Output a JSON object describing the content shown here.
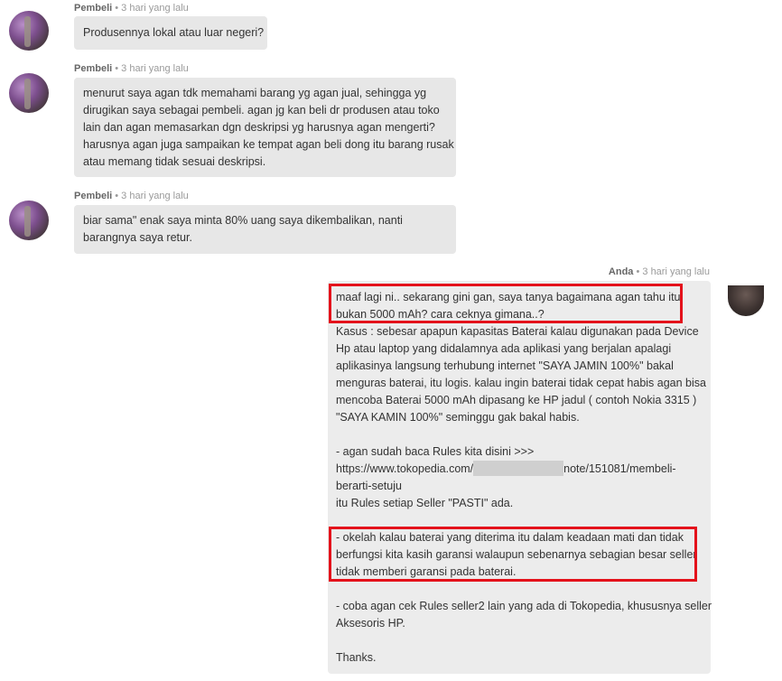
{
  "messages": [
    {
      "sender": "Pembeli",
      "time": "3 hari yang lalu",
      "lines": [
        "Produsennya lokal atau luar negeri?"
      ]
    },
    {
      "sender": "Pembeli",
      "time": "3 hari yang lalu",
      "lines": [
        "menurut saya agan tdk memahami barang yg agan jual, sehingga yg",
        "dirugikan saya sebagai pembeli. agan jg kan beli dr produsen atau toko",
        "lain dan agan memasarkan dgn deskripsi yg harusnya agan mengerti?",
        "harusnya agan juga sampaikan ke tempat agan beli dong itu barang rusak",
        "atau memang tidak sesuai deskripsi."
      ]
    },
    {
      "sender": "Pembeli",
      "time": "3 hari yang lalu",
      "lines": [
        "biar sama\" enak saya minta 80% uang saya dikembalikan, nanti",
        "barangnya saya retur."
      ]
    }
  ],
  "reply": {
    "sender": "Anda",
    "time": "3 hari yang lalu",
    "lines": [
      "maaf lagi ni.. sekarang gini gan, saya tanya bagaimana agan tahu itu",
      "bukan 5000 mAh? cara ceknya gimana..?",
      "Kasus : sebesar apapun kapasitas Baterai kalau digunakan pada Device",
      "Hp atau laptop yang didalamnya ada aplikasi yang berjalan apalagi",
      "aplikasinya langsung terhubung internet \"SAYA JAMIN 100%\" bakal",
      "menguras baterai, itu logis. kalau ingin baterai tidak cepat habis agan bisa",
      "mencoba Baterai 5000 mAh dipasang ke HP jadul ( contoh Nokia 3315 )",
      "\"SAYA KAMIN 100%\" seminggu gak bakal habis.",
      "",
      "- agan sudah baca Rules kita disini >>>",
      "",
      "berarti-setuju",
      "itu Rules setiap Seller \"PASTI\" ada.",
      "",
      "- okelah kalau baterai yang diterima itu dalam keadaan mati dan tidak",
      "berfungsi kita kasih garansi walaupun sebenarnya sebagian besar seller",
      "tidak memberi garansi pada baterai.",
      "",
      "- coba agan cek Rules seller2 lain yang ada di Tokopedia, khususnya seller",
      "Aksesoris HP.",
      "",
      "Thanks."
    ],
    "url_prefix": "https://www.tokopedia.com/",
    "url_suffix": "note/151081/membeli-"
  },
  "separator": " • ",
  "colors": {
    "bubble": "#e7e7e7",
    "highlight": "#e4121b"
  }
}
